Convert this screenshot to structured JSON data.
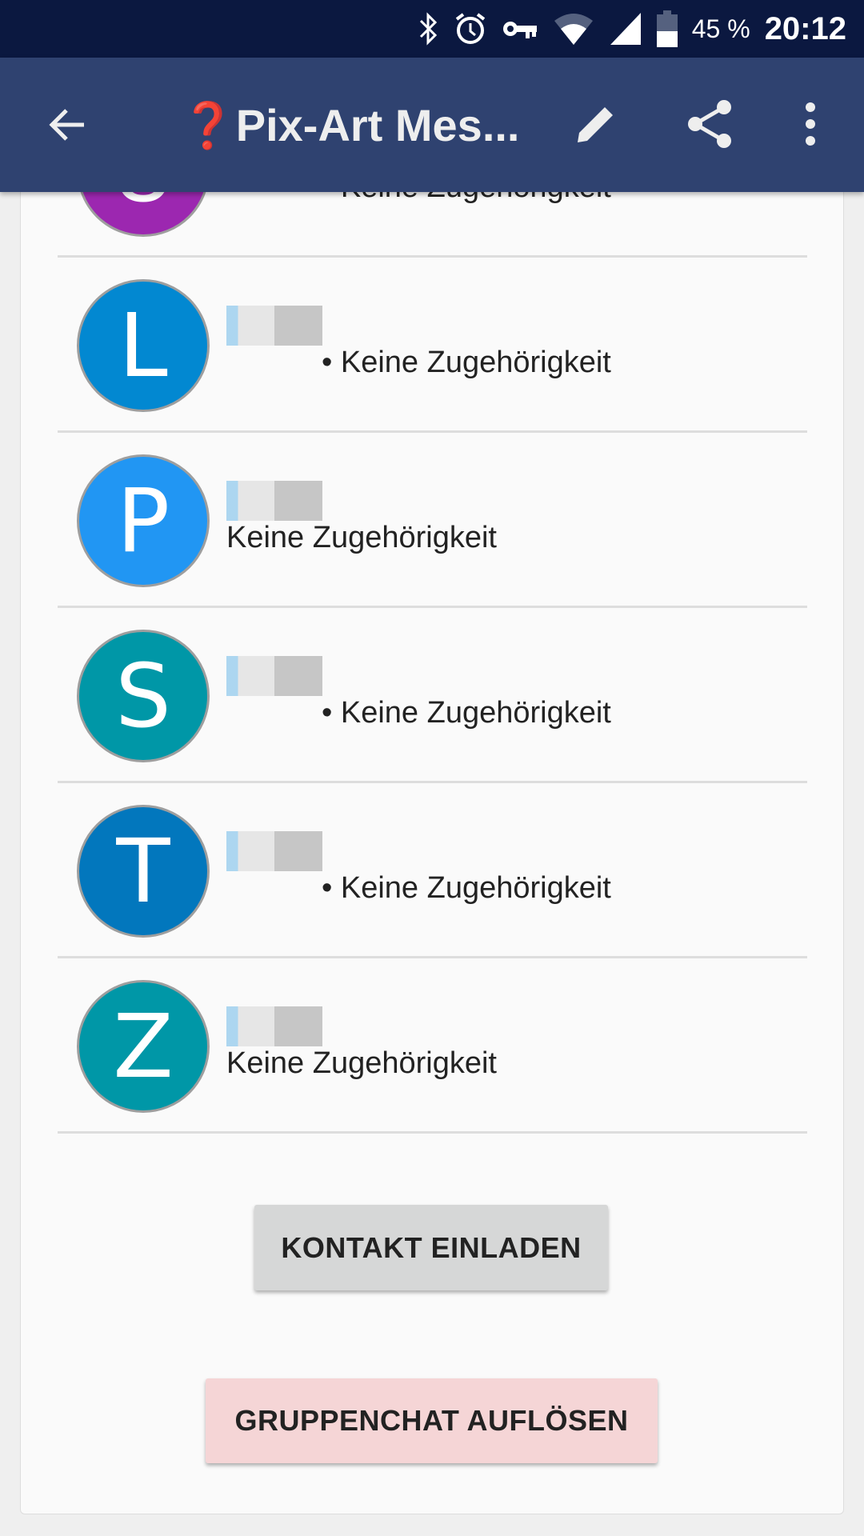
{
  "status_bar": {
    "battery": "45 %",
    "time": "20:12",
    "icons": [
      "bluetooth-icon",
      "alarm-icon",
      "vpn-key-icon",
      "wifi-icon",
      "cell-signal-icon",
      "battery-icon"
    ]
  },
  "app_bar": {
    "title_emoji": "❓",
    "title": "Pix-Art Mes...",
    "icons": [
      "back-arrow-icon",
      "edit-icon",
      "share-icon",
      "more-vert-icon"
    ]
  },
  "members": [
    {
      "initial": "U",
      "color": "#9c27b0",
      "affiliation": "• Keine Zugehörigkeit"
    },
    {
      "initial": "L",
      "color": "#0288d1",
      "affiliation": "• Keine Zugehörigkeit"
    },
    {
      "initial": "P",
      "color": "#2196f3",
      "affiliation": "Keine Zugehörigkeit"
    },
    {
      "initial": "S",
      "color": "#0097a7",
      "affiliation": "• Keine Zugehörigkeit"
    },
    {
      "initial": "T",
      "color": "#0277bd",
      "affiliation": "• Keine Zugehörigkeit"
    },
    {
      "initial": "Z",
      "color": "#0097a7",
      "affiliation": "Keine Zugehörigkeit"
    }
  ],
  "buttons": {
    "invite": "KONTAKT EINLADEN",
    "dissolve": "GRUPPENCHAT AUFLÖSEN"
  },
  "colors": {
    "status_bar": "#0b1840",
    "app_bar": "#2f4270",
    "invite_button": "#d6d7d7",
    "dissolve_button": "#f5d5d6"
  }
}
